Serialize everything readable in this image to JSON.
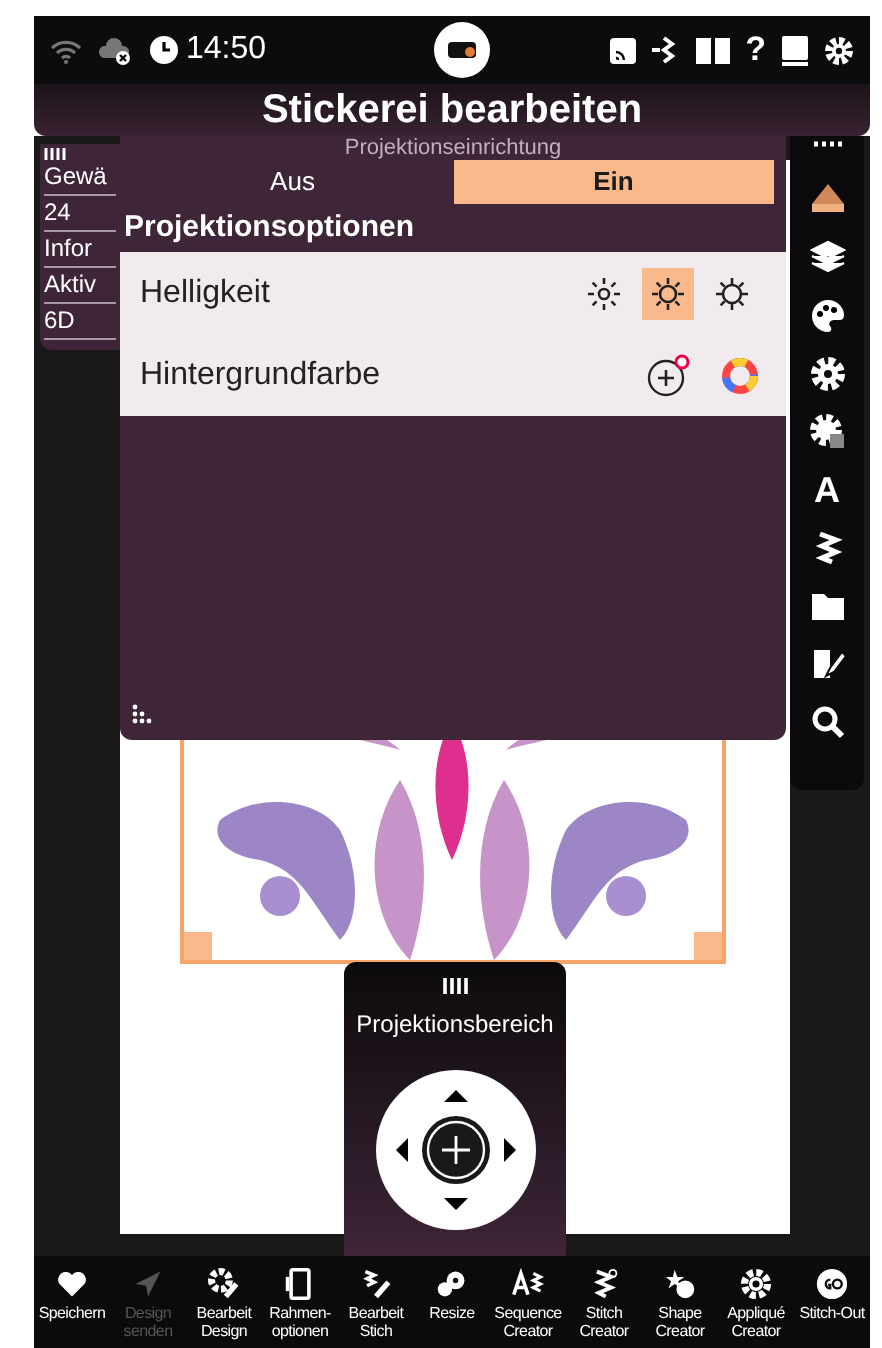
{
  "status_bar": {
    "time": "14:50",
    "help_glyph": "?"
  },
  "title": "Stickerei bearbeiten",
  "info_panel": {
    "lines": [
      "Gewä",
      "24",
      "Infor",
      "Aktiv",
      "6D"
    ]
  },
  "popup": {
    "title": "Projektionseinrichtung",
    "tabs": [
      {
        "label": "Aus",
        "selected": false
      },
      {
        "label": "Ein",
        "selected": true
      }
    ],
    "section": "Projektionsoptionen",
    "rows": [
      {
        "kind": "brightness",
        "label": "Helligkeit",
        "options": [
          {
            "selected": false
          },
          {
            "selected": true
          },
          {
            "selected": false
          }
        ]
      },
      {
        "kind": "color",
        "label": "Hintergrundfarbe"
      }
    ]
  },
  "toolbar": {
    "items": [
      {
        "kind": "hoop"
      },
      {
        "kind": "layers"
      },
      {
        "kind": "palette"
      },
      {
        "kind": "gear"
      },
      {
        "kind": "gear-grid"
      },
      {
        "kind": "text",
        "glyph": "A"
      },
      {
        "kind": "zigzag"
      },
      {
        "kind": "folder"
      },
      {
        "kind": "edit"
      },
      {
        "kind": "search"
      }
    ]
  },
  "projection_area": {
    "title": "Projektionsbereich"
  },
  "bottom_bar": [
    {
      "kind": "heart",
      "label": "Speichern",
      "disabled": false
    },
    {
      "kind": "send",
      "label": "Design senden",
      "disabled": true
    },
    {
      "kind": "edit-design",
      "label": "Bearbeit Design",
      "disabled": false
    },
    {
      "kind": "frame",
      "label": "Rahmen-optionen",
      "disabled": false
    },
    {
      "kind": "edit-stitch",
      "label": "Bearbeit Stich",
      "disabled": false
    },
    {
      "kind": "resize",
      "label": "Resize",
      "disabled": false
    },
    {
      "kind": "sequence",
      "label": "Sequence Creator",
      "disabled": false
    },
    {
      "kind": "stitch",
      "label": "Stitch Creator",
      "disabled": false
    },
    {
      "kind": "shape",
      "label": "Shape Creator",
      "disabled": false
    },
    {
      "kind": "applique",
      "label": "Appliqué Creator",
      "disabled": false
    },
    {
      "kind": "go",
      "label": "Stitch-Out",
      "disabled": false
    }
  ]
}
